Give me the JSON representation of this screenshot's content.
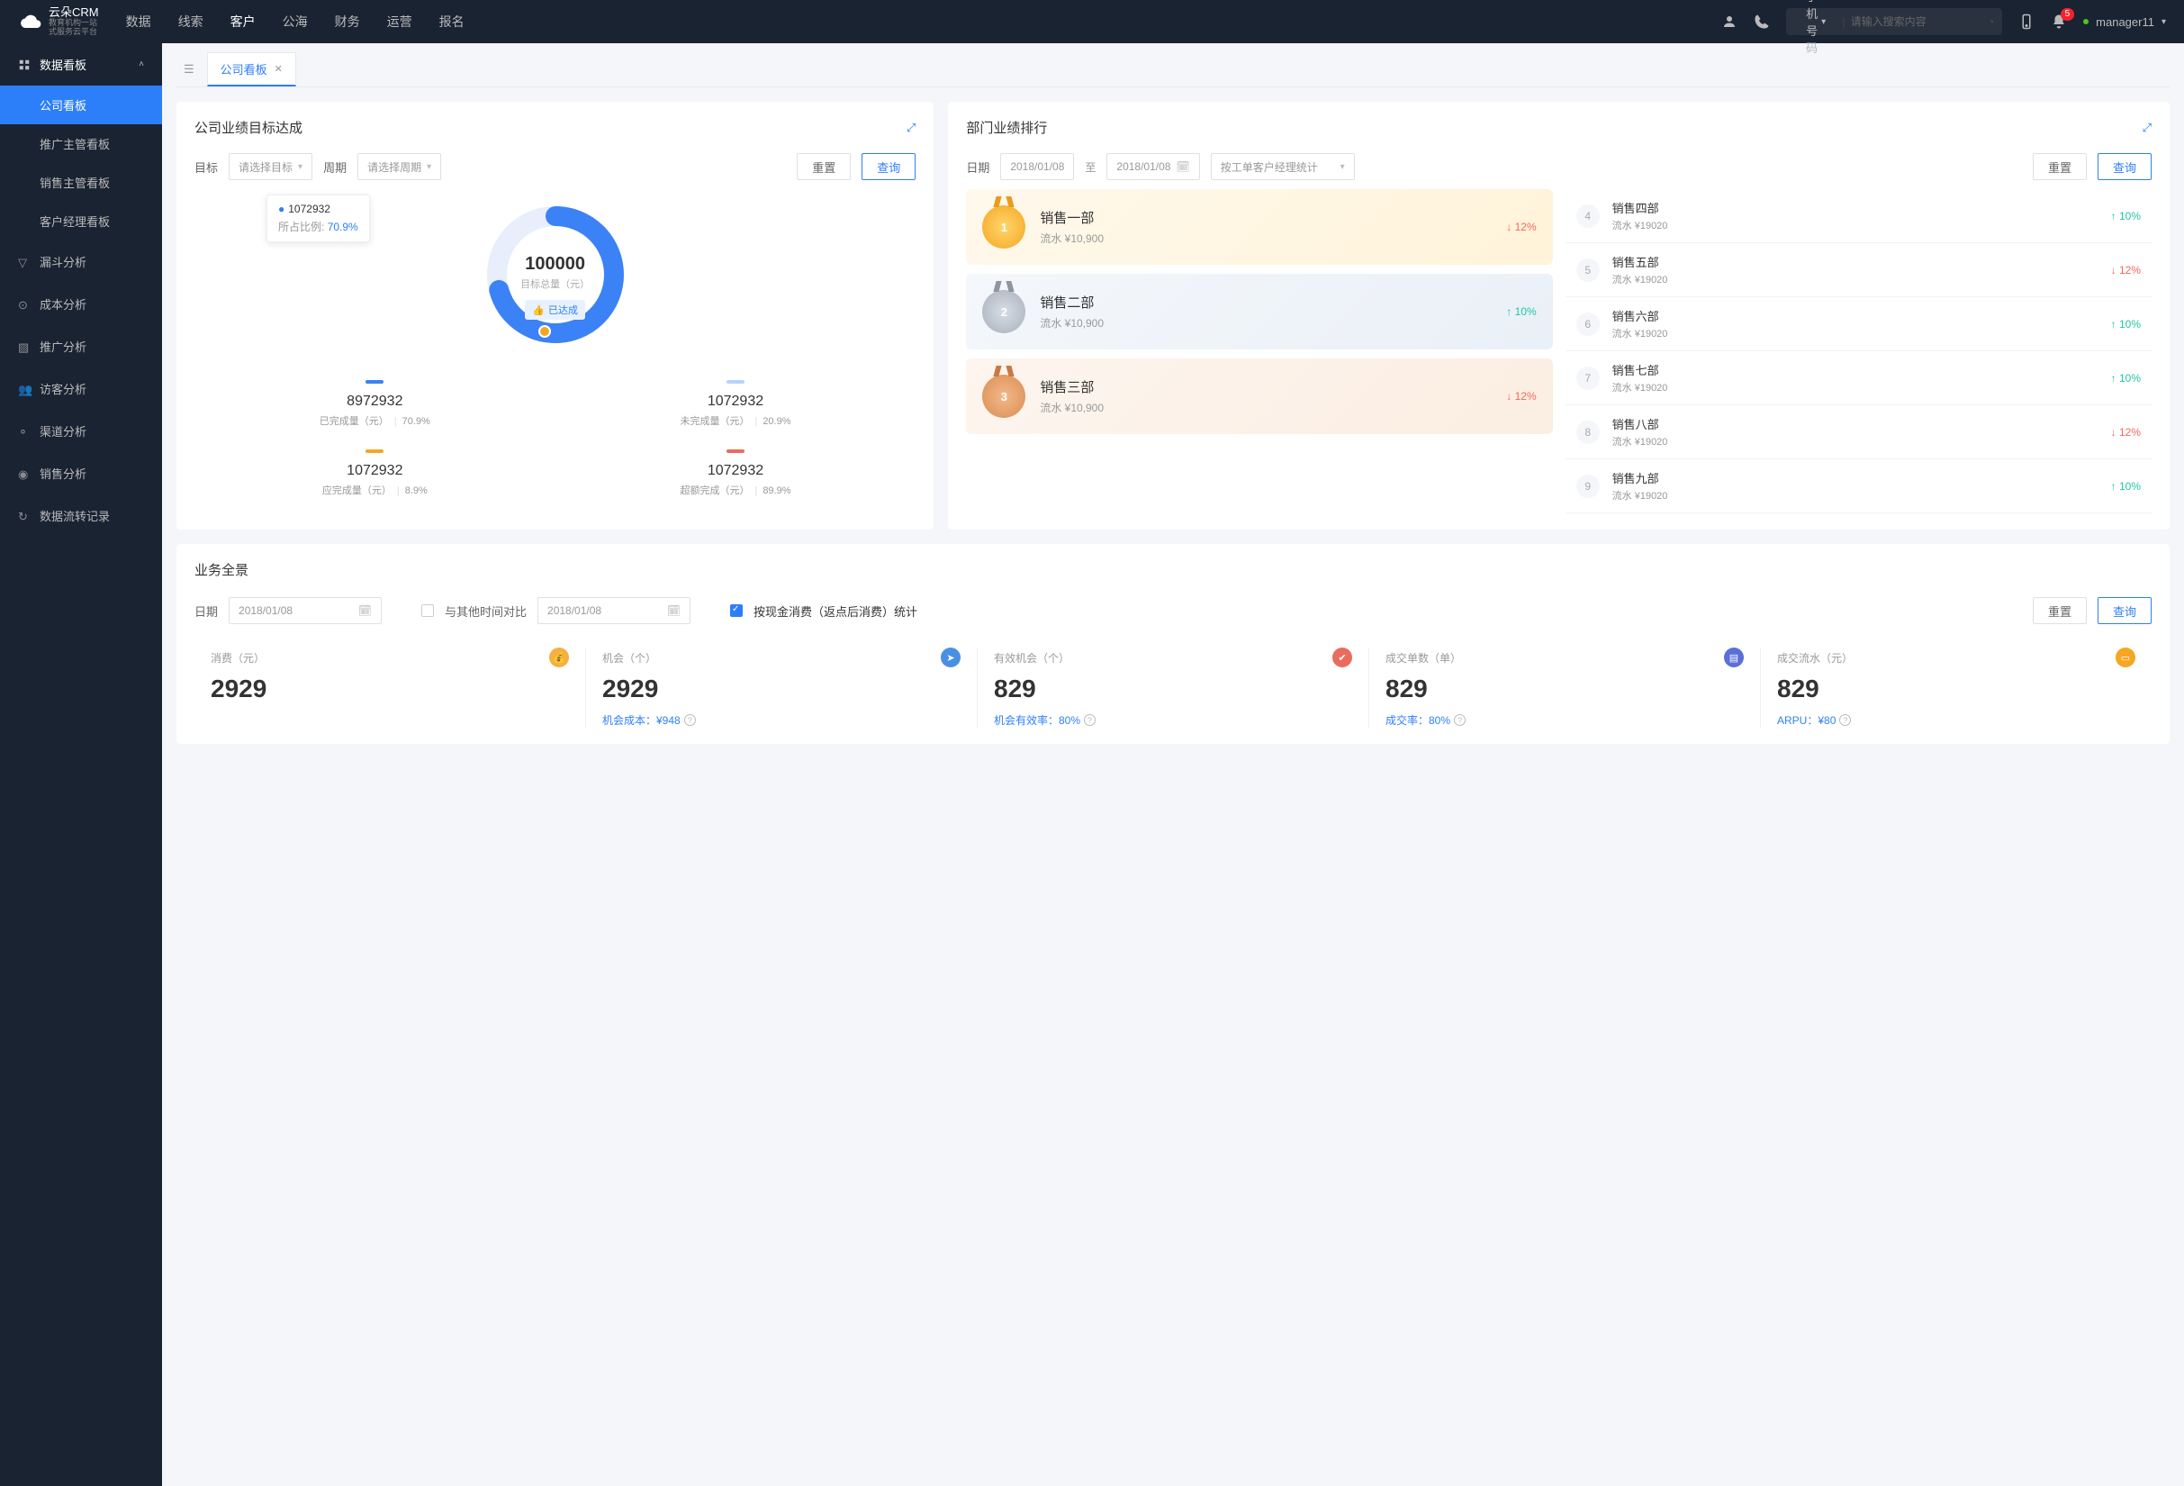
{
  "brand": {
    "name": "云朵CRM",
    "sub1": "教育机构一站",
    "sub2": "式服务云平台"
  },
  "topnav": [
    "数据",
    "线索",
    "客户",
    "公海",
    "财务",
    "运营",
    "报名"
  ],
  "topnav_active": 2,
  "search": {
    "type": "手机号码",
    "placeholder": "请输入搜索内容"
  },
  "notif_count": "5",
  "user": "manager11",
  "sidebar": {
    "group": "数据看板",
    "subs": [
      "公司看板",
      "推广主管看板",
      "销售主管看板",
      "客户经理看板"
    ],
    "subs_active": 0,
    "items": [
      "漏斗分析",
      "成本分析",
      "推广分析",
      "访客分析",
      "渠道分析",
      "销售分析",
      "数据流转记录"
    ]
  },
  "tab": "公司看板",
  "goal": {
    "title": "公司业绩目标达成",
    "target_lbl": "目标",
    "target_ph": "请选择目标",
    "period_lbl": "周期",
    "period_ph": "请选择周期",
    "reset": "重置",
    "query": "查询",
    "tooltip_val": "1072932",
    "tooltip_lbl": "所占比例:",
    "tooltip_pct": "70.9%",
    "center_val": "100000",
    "center_lbl": "目标总量（元）",
    "center_tag": "已达成",
    "stats": [
      {
        "bar": "#3b82f6",
        "val": "8972932",
        "lbl": "已完成量（元）",
        "pct": "70.9%"
      },
      {
        "bar": "#b3d4fc",
        "val": "1072932",
        "lbl": "未完成量（元）",
        "pct": "20.9%"
      },
      {
        "bar": "#f5a623",
        "val": "1072932",
        "lbl": "应完成量（元）",
        "pct": "8.9%"
      },
      {
        "bar": "#e96c5f",
        "val": "1072932",
        "lbl": "超额完成（元）",
        "pct": "89.9%"
      }
    ]
  },
  "rank": {
    "title": "部门业绩排行",
    "date_lbl": "日期",
    "from": "2018/01/08",
    "to_lbl": "至",
    "to": "2018/01/08",
    "stat_by": "按工单客户经理统计",
    "reset": "重置",
    "query": "查询",
    "podium": [
      {
        "name": "销售一部",
        "amt": "流水 ¥10,900",
        "trend": "12%",
        "dir": "down"
      },
      {
        "name": "销售二部",
        "amt": "流水 ¥10,900",
        "trend": "10%",
        "dir": "up"
      },
      {
        "name": "销售三部",
        "amt": "流水 ¥10,900",
        "trend": "12%",
        "dir": "down"
      }
    ],
    "list": [
      {
        "n": "4",
        "name": "销售四部",
        "amt": "流水 ¥19020",
        "trend": "10%",
        "dir": "up"
      },
      {
        "n": "5",
        "name": "销售五部",
        "amt": "流水 ¥19020",
        "trend": "12%",
        "dir": "down"
      },
      {
        "n": "6",
        "name": "销售六部",
        "amt": "流水 ¥19020",
        "trend": "10%",
        "dir": "up"
      },
      {
        "n": "7",
        "name": "销售七部",
        "amt": "流水 ¥19020",
        "trend": "10%",
        "dir": "up"
      },
      {
        "n": "8",
        "name": "销售八部",
        "amt": "流水 ¥19020",
        "trend": "12%",
        "dir": "down"
      },
      {
        "n": "9",
        "name": "销售九部",
        "amt": "流水 ¥19020",
        "trend": "10%",
        "dir": "up"
      }
    ]
  },
  "biz": {
    "title": "业务全景",
    "date_lbl": "日期",
    "date": "2018/01/08",
    "compare_lbl": "与其他时间对比",
    "date2": "2018/01/08",
    "check_lbl": "按现金消费（返点后消费）统计",
    "reset": "重置",
    "query": "查询",
    "metrics": [
      {
        "lbl": "消费（元）",
        "val": "2929",
        "sub": "",
        "cls": "ic-yellow",
        "glyph": "💰"
      },
      {
        "lbl": "机会（个）",
        "val": "2929",
        "sub": "机会成本：¥948",
        "cls": "ic-blue",
        "glyph": "➤"
      },
      {
        "lbl": "有效机会（个）",
        "val": "829",
        "sub": "机会有效率：80%",
        "cls": "ic-red",
        "glyph": "✔"
      },
      {
        "lbl": "成交单数（单）",
        "val": "829",
        "sub": "成交率：80%",
        "cls": "ic-purple",
        "glyph": "▤"
      },
      {
        "lbl": "成交流水（元）",
        "val": "829",
        "sub": "ARPU：¥80",
        "cls": "ic-orange",
        "glyph": "▭"
      }
    ]
  },
  "chart_data": {
    "type": "pie",
    "title": "公司业绩目标达成",
    "center_label": "目标总量（元）",
    "center_value": 100000,
    "series": [
      {
        "name": "已完成量（元）",
        "value": 8972932,
        "pct": 70.9,
        "color": "#3b82f6"
      },
      {
        "name": "未完成量（元）",
        "value": 1072932,
        "pct": 20.9,
        "color": "#b3d4fc"
      },
      {
        "name": "应完成量（元）",
        "value": 1072932,
        "pct": 8.9,
        "color": "#f5a623"
      },
      {
        "name": "超额完成（元）",
        "value": 1072932,
        "pct": 89.9,
        "color": "#e96c5f"
      }
    ],
    "tooltip": {
      "value": 1072932,
      "label": "所占比例",
      "pct": 70.9
    }
  }
}
